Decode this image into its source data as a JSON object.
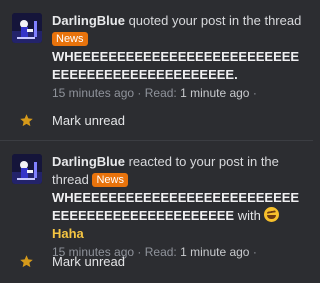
{
  "alerts": [
    {
      "username": "DarlingBlue",
      "action_text": " quoted your post in the thread ",
      "badge": "News",
      "post_title": "WHEEEEEEEEEEEEEEEEEEEEEEEEEEEEEEEEEEEEEEEEEEEEEEE.",
      "time_ago": "15 minutes ago",
      "sep1": " · ",
      "read_label": "Read: ",
      "read_value": "1 minute ago",
      "sep2": " ·",
      "mark_label": "Mark unread"
    },
    {
      "username": "DarlingBlue",
      "action_text": " reacted to your post in the thread ",
      "badge": "News",
      "post_title": "WHEEEEEEEEEEEEEEEEEEEEEEEEEEEEEEEEEEEEEEEEEEEEEEE",
      "with_text": " with ",
      "reaction_label": " Haha",
      "reaction_icon": "laughing-emoji-icon",
      "time_ago": "15 minutes ago",
      "sep1": " · ",
      "read_label": "Read: ",
      "read_value": "1 minute ago",
      "sep2": " ·",
      "mark_label": "Mark unread"
    }
  ],
  "colors": {
    "background": "#2c2d31",
    "badge": "#e8730c",
    "star": "#d69a1a",
    "reaction": "#f5c542",
    "muted": "#8f939b"
  }
}
